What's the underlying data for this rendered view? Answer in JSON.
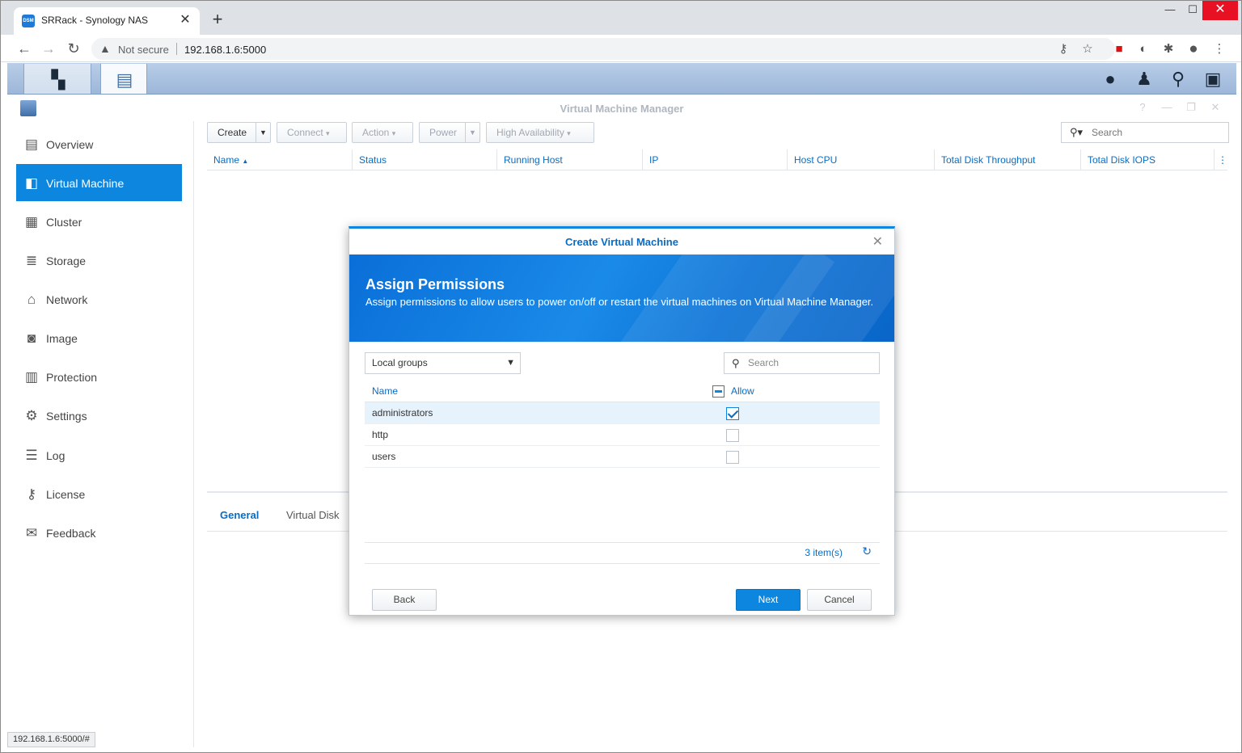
{
  "browser": {
    "tab_title": "SRRack - Synology NAS",
    "favicon_text": "DSM",
    "security_label": "Not secure",
    "url": "192.168.1.6:5000",
    "status_url": "192.168.1.6:5000/#"
  },
  "app": {
    "title": "Virtual Machine Manager"
  },
  "sidebar": {
    "items": [
      {
        "label": "Overview",
        "icon": "overview-icon"
      },
      {
        "label": "Virtual Machine",
        "icon": "virtual-machine-icon"
      },
      {
        "label": "Cluster",
        "icon": "cluster-icon"
      },
      {
        "label": "Storage",
        "icon": "storage-icon"
      },
      {
        "label": "Network",
        "icon": "network-icon"
      },
      {
        "label": "Image",
        "icon": "image-icon"
      },
      {
        "label": "Protection",
        "icon": "protection-icon"
      },
      {
        "label": "Settings",
        "icon": "gear-icon"
      },
      {
        "label": "Log",
        "icon": "log-icon"
      },
      {
        "label": "License",
        "icon": "key-icon"
      },
      {
        "label": "Feedback",
        "icon": "mail-icon"
      }
    ]
  },
  "toolbar": {
    "create": "Create",
    "connect": "Connect",
    "action": "Action",
    "power": "Power",
    "high_availability": "High Availability",
    "search_placeholder": "Search"
  },
  "grid": {
    "columns": [
      "Name",
      "Status",
      "Running Host",
      "IP",
      "Host CPU",
      "Total Disk Throughput",
      "Total Disk IOPS"
    ]
  },
  "detail_tabs": [
    "General",
    "Virtual Disk"
  ],
  "dialog": {
    "title": "Create Virtual Machine",
    "heading": "Assign Permissions",
    "description": "Assign permissions to allow users to power on/off or restart the virtual machines on Virtual Machine Manager.",
    "group_select": "Local groups",
    "search_placeholder": "Search",
    "col_name": "Name",
    "col_allow": "Allow",
    "rows": [
      {
        "name": "administrators",
        "allow": true
      },
      {
        "name": "http",
        "allow": false
      },
      {
        "name": "users",
        "allow": false
      }
    ],
    "item_count": "3 item(s)",
    "back": "Back",
    "next": "Next",
    "cancel": "Cancel"
  },
  "colors": {
    "accent": "#0d86e0",
    "link": "#0a6cc2"
  }
}
